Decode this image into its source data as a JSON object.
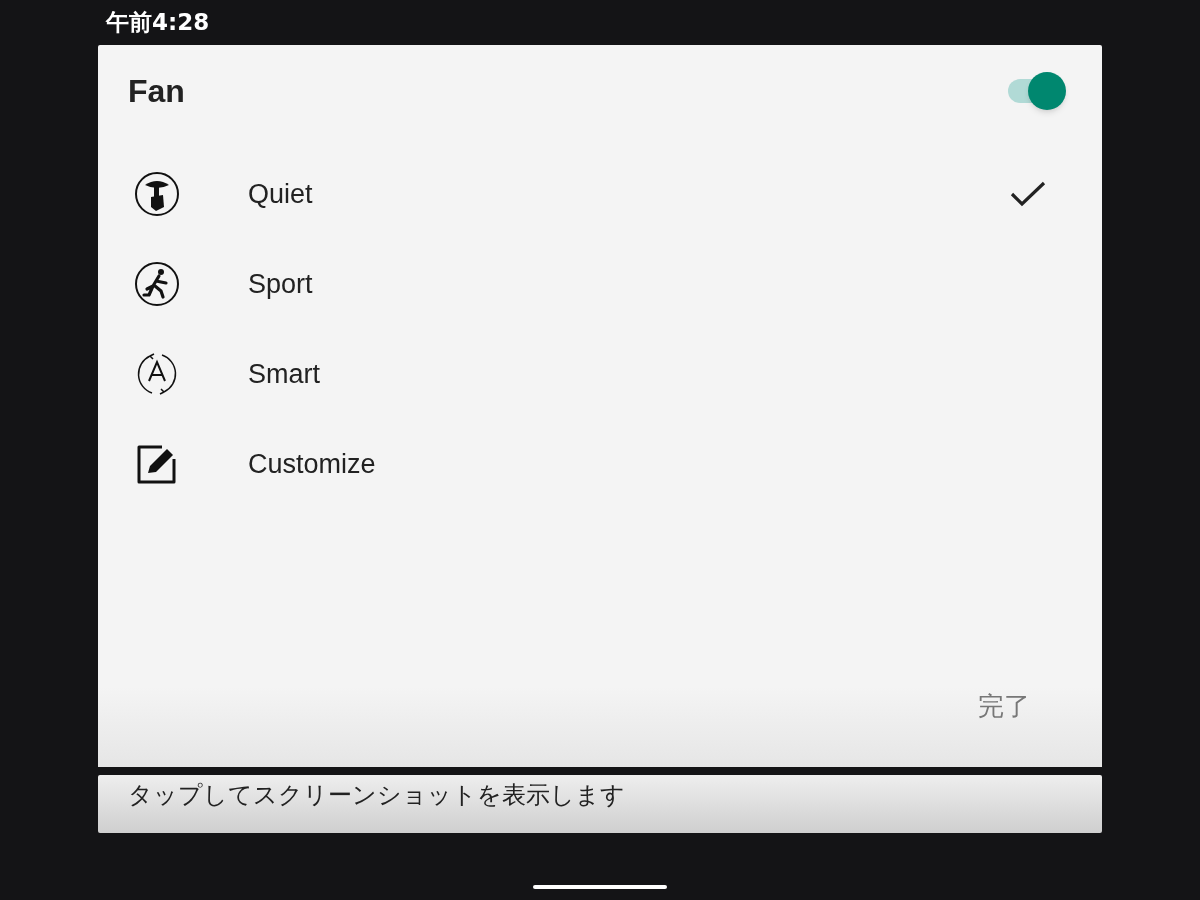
{
  "status_bar": {
    "time": "午前4:28"
  },
  "dialog": {
    "title": "Fan",
    "switch_on": true,
    "options": [
      {
        "kind": "quiet",
        "label": "Quiet",
        "selected": true
      },
      {
        "kind": "sport",
        "label": "Sport",
        "selected": false
      },
      {
        "kind": "smart",
        "label": "Smart",
        "selected": false
      },
      {
        "kind": "customize",
        "label": "Customize",
        "selected": false
      }
    ],
    "done_button": "完了"
  },
  "notification": {
    "text": "タップしてスクリーンショットを表示します"
  }
}
